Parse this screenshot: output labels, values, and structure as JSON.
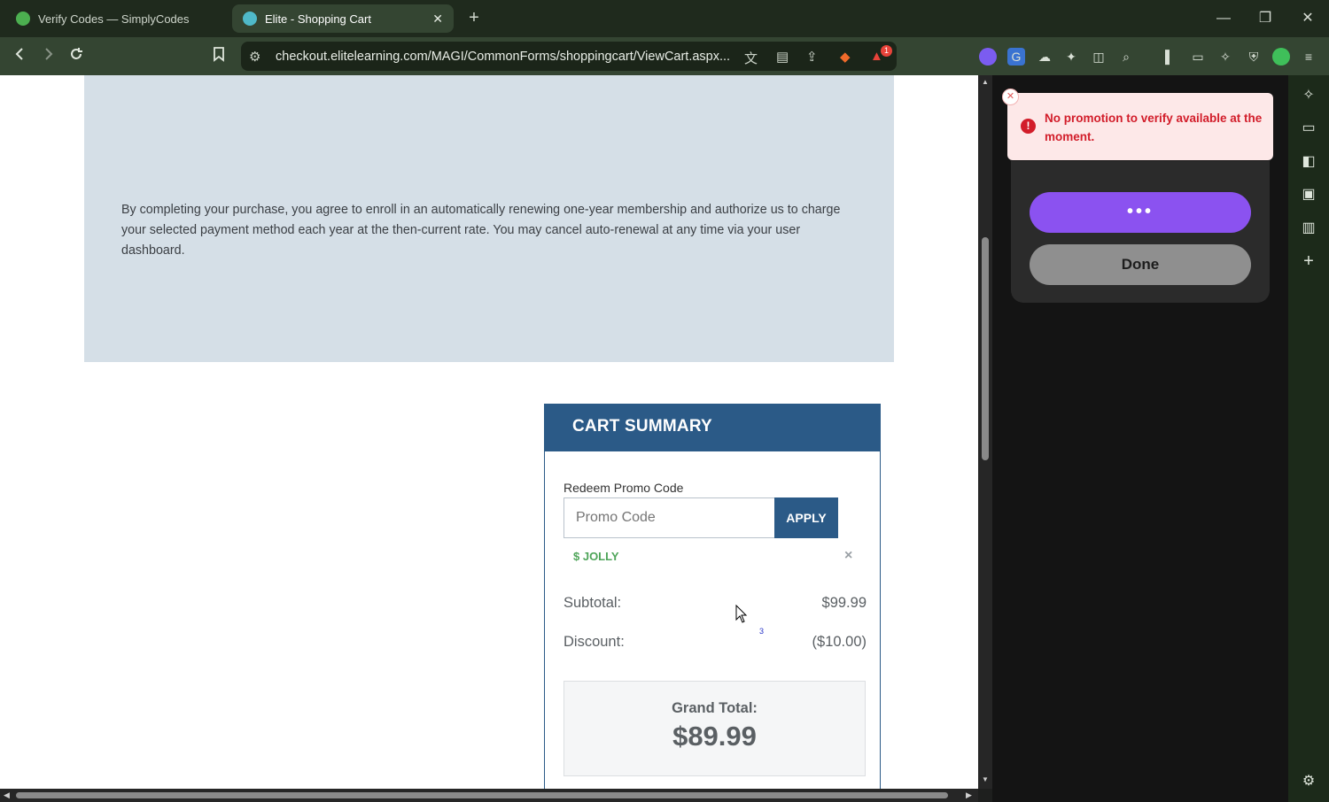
{
  "tabs": [
    {
      "title": "Verify Codes — SimplyCodes",
      "favicon_color": "#4caf50"
    },
    {
      "title": "Elite - Shopping Cart",
      "favicon_color": "#4fb9c9"
    }
  ],
  "toolbar": {
    "url": "checkout.elitelearning.com/MAGI/CommonForms/shoppingcart/ViewCart.aspx...",
    "notification_badge": "1"
  },
  "page": {
    "auto_renew_notice": "By completing your purchase, you agree to enroll in an automatically renewing one-year membership and authorize us to charge your selected payment method each year at the then-current rate. You may cancel auto-renewal at any time via your user dashboard."
  },
  "cart": {
    "title": "CART SUMMARY",
    "promo_label": "Redeem Promo Code",
    "promo_placeholder": "Promo Code",
    "apply_label": "APPLY",
    "applied_coupon": "$ JOLLY",
    "remove_symbol": "×",
    "subtotal_label": "Subtotal:",
    "subtotal_value": "$99.99",
    "discount_label": "Discount:",
    "discount_value": "($10.00)",
    "grand_total_label": "Grand Total:",
    "grand_total_value": "$89.99"
  },
  "overlay_note": "3",
  "sidepanel": {
    "toast_message": "No promotion to verify available at the moment.",
    "primary_button_label": "•••",
    "done_button_label": "Done"
  },
  "colors": {
    "cart_header": "#2b5a87",
    "coupon_green": "#4fa55a",
    "error_red": "#d21d2a",
    "purple_button": "#8b52f0"
  }
}
